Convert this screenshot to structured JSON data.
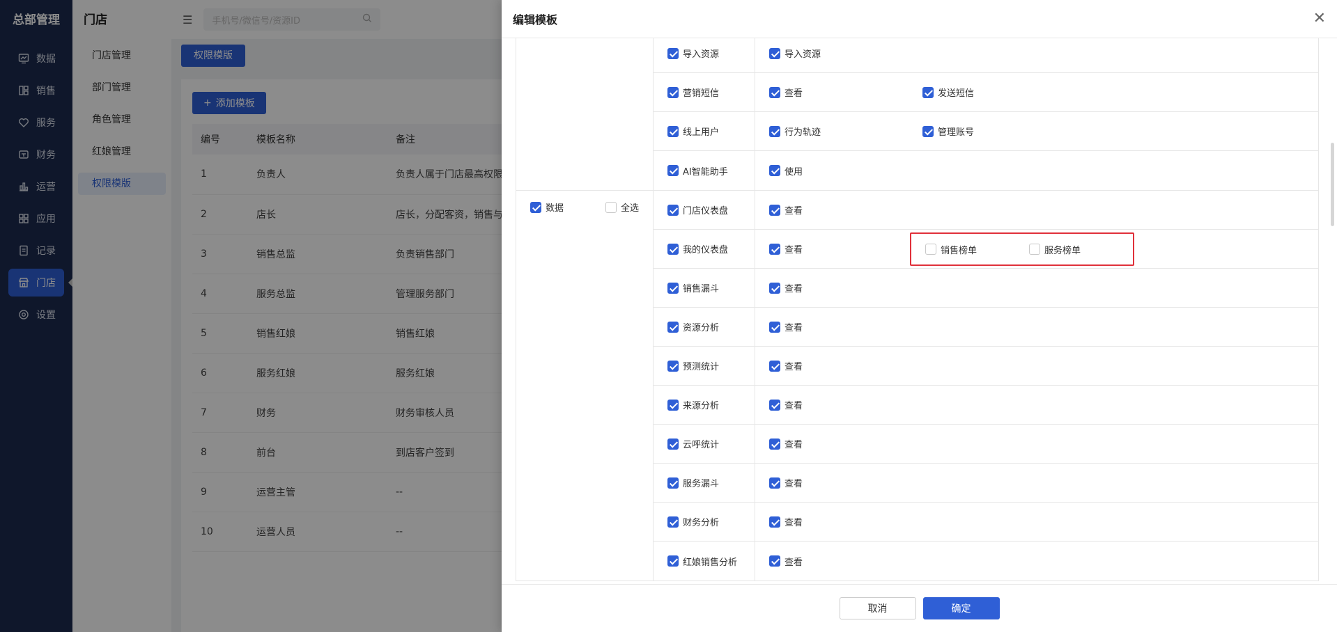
{
  "nav": {
    "brand": "总部管理",
    "items": [
      {
        "label": "数据",
        "icon": "chart-icon"
      },
      {
        "label": "销售",
        "icon": "layout-icon"
      },
      {
        "label": "服务",
        "icon": "heart-icon"
      },
      {
        "label": "财务",
        "icon": "wallet-icon"
      },
      {
        "label": "运营",
        "icon": "bar-chart-icon"
      },
      {
        "label": "应用",
        "icon": "apps-icon"
      },
      {
        "label": "记录",
        "icon": "document-icon"
      },
      {
        "label": "门店",
        "icon": "store-icon"
      },
      {
        "label": "设置",
        "icon": "settings-icon"
      }
    ],
    "active_index": 7
  },
  "sub": {
    "title": "门店",
    "items": [
      "门店管理",
      "部门管理",
      "角色管理",
      "红娘管理",
      "权限模版"
    ],
    "active_index": 4
  },
  "topbar": {
    "search_placeholder": "手机号/微信号/资源ID"
  },
  "main": {
    "tab_label": "权限模版",
    "add_button": "添加模板",
    "table": {
      "headers": [
        "编号",
        "模板名称",
        "备注"
      ],
      "rows": [
        [
          "1",
          "负责人",
          "负责人属于门店最高权限"
        ],
        [
          "2",
          "店长",
          "店长，分配客资，销售与"
        ],
        [
          "3",
          "销售总监",
          "负责销售部门"
        ],
        [
          "4",
          "服务总监",
          "管理服务部门"
        ],
        [
          "5",
          "销售红娘",
          "销售红娘"
        ],
        [
          "6",
          "服务红娘",
          "服务红娘"
        ],
        [
          "7",
          "财务",
          "财务审核人员"
        ],
        [
          "8",
          "前台",
          "到店客户签到"
        ],
        [
          "9",
          "运营主管",
          "--"
        ],
        [
          "10",
          "运营人员",
          "--"
        ]
      ]
    }
  },
  "drawer": {
    "title": "编辑模板",
    "cancel_label": "取消",
    "ok_label": "确定",
    "group1": {
      "rows": [
        {
          "module": "导入资源",
          "perms": [
            {
              "label": "导入资源",
              "checked": true
            }
          ]
        },
        {
          "module": "营销短信",
          "perms": [
            {
              "label": "查看",
              "checked": true
            },
            {
              "label": "发送短信",
              "checked": true
            }
          ]
        },
        {
          "module": "线上用户",
          "perms": [
            {
              "label": "行为轨迹",
              "checked": true
            },
            {
              "label": "管理账号",
              "checked": true
            }
          ]
        },
        {
          "module": "AI智能助手",
          "perms": [
            {
              "label": "使用",
              "checked": true
            }
          ]
        }
      ]
    },
    "group2": {
      "label": "数据",
      "select_all": "全选",
      "rows": [
        {
          "module": "门店仪表盘",
          "perms": [
            {
              "label": "查看",
              "checked": true
            }
          ]
        },
        {
          "module": "我的仪表盘",
          "perms": [
            {
              "label": "查看",
              "checked": true
            }
          ],
          "extra": [
            {
              "label": "销售榜单",
              "checked": false
            },
            {
              "label": "服务榜单",
              "checked": false
            }
          ]
        },
        {
          "module": "销售漏斗",
          "perms": [
            {
              "label": "查看",
              "checked": true
            }
          ]
        },
        {
          "module": "资源分析",
          "perms": [
            {
              "label": "查看",
              "checked": true
            }
          ]
        },
        {
          "module": "预测统计",
          "perms": [
            {
              "label": "查看",
              "checked": true
            }
          ]
        },
        {
          "module": "来源分析",
          "perms": [
            {
              "label": "查看",
              "checked": true
            }
          ]
        },
        {
          "module": "云呼统计",
          "perms": [
            {
              "label": "查看",
              "checked": true
            }
          ]
        },
        {
          "module": "服务漏斗",
          "perms": [
            {
              "label": "查看",
              "checked": true
            }
          ]
        },
        {
          "module": "财务分析",
          "perms": [
            {
              "label": "查看",
              "checked": true
            }
          ]
        },
        {
          "module": "红娘销售分析",
          "perms": [
            {
              "label": "查看",
              "checked": true
            }
          ]
        }
      ]
    }
  },
  "colors": {
    "primary": "#2f5fd6",
    "nav_bg": "#1c2b4f",
    "highlight_border": "#e0303a"
  }
}
